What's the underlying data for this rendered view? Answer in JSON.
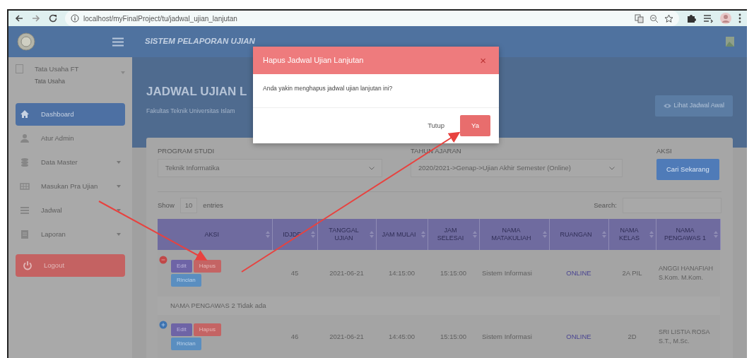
{
  "browser": {
    "url": "localhost/myFinalProject/tu/jadwal_ujian_lanjutan"
  },
  "navbar": {
    "title": "SISTEM PELAPORAN UJIAN"
  },
  "sidebar": {
    "user_name": "Tata Usaha FT",
    "user_role": "Tata Usaha",
    "items": [
      {
        "label": "Dashboard",
        "selected": true,
        "has_caret": false
      },
      {
        "label": "Atur Admin",
        "selected": false,
        "has_caret": false
      },
      {
        "label": "Data Master",
        "selected": false,
        "has_caret": true
      },
      {
        "label": "Masukan Pra Ujian",
        "selected": false,
        "has_caret": true
      },
      {
        "label": "Jadwal",
        "selected": false,
        "has_caret": true
      },
      {
        "label": "Laporan",
        "selected": false,
        "has_caret": true
      }
    ],
    "logout": "Logout"
  },
  "page": {
    "heading": "JADWAL UJIAN L",
    "subtitle": "Fakultas Teknik Universitas Islam",
    "view_button": "Lihat Jadwal Awal"
  },
  "filter": {
    "program_label": "PROGRAM STUDI",
    "program_value": "Teknik Informatika",
    "year_label": "TAHUN AJARAN",
    "year_value": "2020/2021->Genap->Ujian Akhir Semester (Online)",
    "action_label": "AKSI",
    "search_button": "Cari Sekarang"
  },
  "table_controls": {
    "show": "Show",
    "length": "10",
    "entries": "entries",
    "search_label": "Search:"
  },
  "table": {
    "columns": [
      "AKSI",
      "IDJDF",
      "TANGGAL UJIAN",
      "JAM MULAI",
      "JAM SELESAI",
      "NAMA MATAKULIAH",
      "RUANGAN",
      "NAMA KELAS",
      "NAMA PENGAWAS 1"
    ],
    "rows": [
      {
        "expanded": true,
        "cells": [
          [
            "Edit",
            "Hapus",
            "Rincian"
          ],
          "45",
          "2021-06-21",
          "14:15:00",
          "15:15:00",
          "Sistem Informasi",
          "ONLINE",
          "2A PIL",
          "ANGGI HANAFIAH S.Kom. M.Kom."
        ],
        "details": "NAMA PENGAWAS 2 Tidak ada"
      },
      {
        "expanded": false,
        "cells": [
          [
            "Edit",
            "Hapus",
            "Rincian"
          ],
          "46",
          "2021-06-21",
          "14:45:00",
          "15:15:00",
          "Sistem Informasi",
          "ONLINE",
          "2D",
          "SRI LISTIA ROSA S.T., M.Sc."
        ]
      }
    ]
  },
  "modal": {
    "title": "Hapus Jadwal Ujian Lanjutan",
    "close": "×",
    "message": "Anda yakin menghapus jadwal ujian lanjutan ini?",
    "buttons": [
      {
        "label": "Tutup",
        "kind": "secondary"
      },
      {
        "label": "Ya",
        "kind": "danger"
      }
    ]
  }
}
